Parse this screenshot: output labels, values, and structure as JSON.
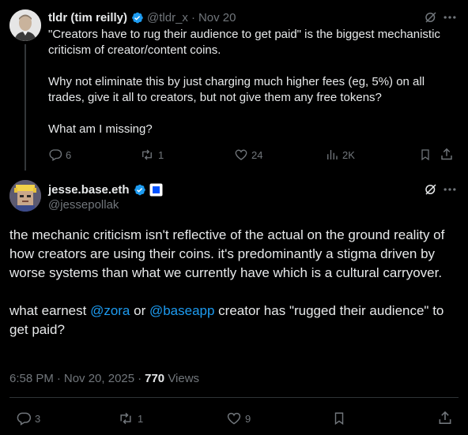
{
  "tweet1": {
    "name": "tldr (tim reilly)",
    "handle": "@tldr_x",
    "separator": "·",
    "date": "Nov 20",
    "paragraphs": [
      "\"Creators have to rug their audience to get paid\" is the biggest mechanistic criticism of creator/content coins.",
      "Why not eliminate this by just charging much higher fees (eg, 5%) on all trades, give it all to creators, but not give them any free tokens?",
      "What am I missing?"
    ],
    "actions": {
      "replies": "6",
      "reposts": "1",
      "likes": "24",
      "views": "2K"
    }
  },
  "tweet2": {
    "name": "jesse.base.eth",
    "handle": "@jessepollak",
    "paragraph1": "the mechanic criticism isn't reflective of the actual on the ground reality of how creators are using their coins. it's predominantly a stigma driven by worse systems than what we currently have which is a cultural carryover.",
    "p2_part1": "what earnest ",
    "mention1": "@zora",
    "p2_part2": " or ",
    "mention2": "@baseapp",
    "p2_part3": " creator has \"rugged their audience\" to get paid?",
    "meta": {
      "time": "6:58 PM",
      "separator1": "·",
      "date": "Nov 20, 2025",
      "separator2": "·",
      "views_count": "770",
      "views_label": "Views"
    },
    "actions": {
      "replies": "3",
      "reposts": "1",
      "likes": "9"
    }
  },
  "colors": {
    "background": "#000000",
    "text": "#e7e9ea",
    "muted": "#71767b",
    "link": "#1d9bf0",
    "verified": "#1d9bf0"
  }
}
